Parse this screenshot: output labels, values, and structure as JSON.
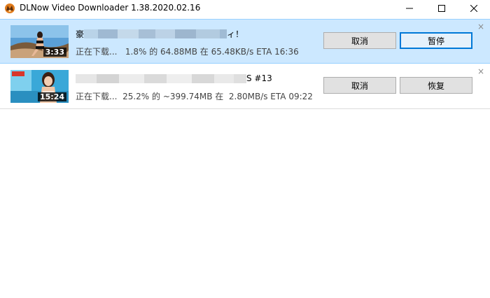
{
  "window": {
    "title": "DLNow Video Downloader 1.38.2020.02.16",
    "icon": "dlnow-app-icon",
    "controls": [
      "minimize-icon",
      "maximize-icon",
      "close-icon"
    ]
  },
  "downloads": [
    {
      "title_visible_start": "豪",
      "title_visible_end": "ィ！",
      "title_obscured": true,
      "duration": "3:33",
      "status": "正在下载...   1.8% 的 64.88MB 在 65.48KB/s ETA 16:36",
      "cancel_label": "取消",
      "action_label": "暂停",
      "selected": true,
      "remove_glyph": "×"
    },
    {
      "title_visible_start": "",
      "title_visible_end": "S #13",
      "title_obscured": true,
      "duration": "15:24",
      "status": "正在下载...  25.2% 的 ~399.74MB 在  2.80MB/s ETA 09:22",
      "cancel_label": "取消",
      "action_label": "恢复",
      "selected": false,
      "remove_glyph": "×"
    }
  ],
  "colors": {
    "selected_row_bg": "#cce8ff",
    "selected_row_border": "#99d1ff",
    "primary_button_border": "#0078d7",
    "button_bg": "#e1e1e1"
  }
}
